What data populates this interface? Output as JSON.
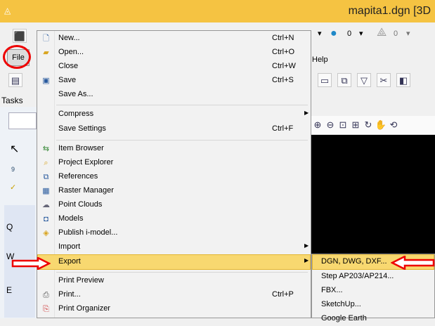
{
  "window": {
    "title": "mapita1.dgn [3D"
  },
  "background": {
    "file_button": "File",
    "tasks_label": "Tasks",
    "help_label": "Help",
    "toolbar_value1": "0",
    "toolbar_value2": "0",
    "left_letters": [
      "Q",
      "W",
      "E"
    ],
    "left_num": "9"
  },
  "file_menu": {
    "items": [
      {
        "label": "New...",
        "shortcut": "Ctrl+N",
        "icon": "new-file-icon"
      },
      {
        "label": "Open...",
        "shortcut": "Ctrl+O",
        "icon": "open-folder-icon"
      },
      {
        "label": "Close",
        "shortcut": "Ctrl+W",
        "icon": ""
      },
      {
        "label": "Save",
        "shortcut": "Ctrl+S",
        "icon": "save-icon"
      },
      {
        "label": "Save As...",
        "shortcut": "",
        "icon": ""
      },
      {
        "label": "Compress",
        "shortcut": "",
        "icon": "",
        "submenu": true
      },
      {
        "label": "Save Settings",
        "shortcut": "Ctrl+F",
        "icon": ""
      },
      {
        "label": "Item Browser",
        "shortcut": "",
        "icon": "item-browser-icon"
      },
      {
        "label": "Project Explorer",
        "shortcut": "",
        "icon": "project-explorer-icon"
      },
      {
        "label": "References",
        "shortcut": "",
        "icon": "references-icon"
      },
      {
        "label": "Raster Manager",
        "shortcut": "",
        "icon": "raster-manager-icon"
      },
      {
        "label": "Point Clouds",
        "shortcut": "",
        "icon": "point-clouds-icon"
      },
      {
        "label": "Models",
        "shortcut": "",
        "icon": "models-icon"
      },
      {
        "label": "Publish i-model...",
        "shortcut": "",
        "icon": "publish-imodel-icon"
      },
      {
        "label": "Import",
        "shortcut": "",
        "icon": "",
        "submenu": true
      },
      {
        "label": "Export",
        "shortcut": "",
        "icon": "",
        "submenu": true,
        "highlighted": true
      },
      {
        "label": "Print Preview",
        "shortcut": "",
        "icon": ""
      },
      {
        "label": "Print...",
        "shortcut": "Ctrl+P",
        "icon": "print-icon"
      },
      {
        "label": "Print Organizer",
        "shortcut": "",
        "icon": "print-organizer-icon"
      }
    ]
  },
  "export_menu": {
    "items": [
      {
        "label": "DGN, DWG, DXF...",
        "highlighted": true
      },
      {
        "label": "Step AP203/AP214..."
      },
      {
        "label": "FBX..."
      },
      {
        "label": "SketchUp..."
      },
      {
        "label": "Google Earth"
      }
    ]
  },
  "colors": {
    "titlebar": "#f5c342",
    "highlight": "#f8d870",
    "annotation_red": "#e00000"
  }
}
